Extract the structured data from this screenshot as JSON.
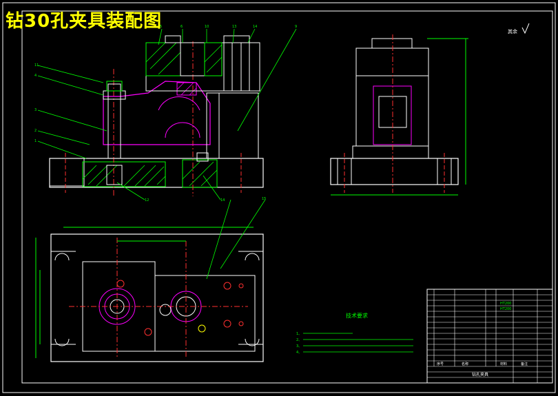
{
  "title": "钻30孔夹具装配图",
  "roughness_mark": "其余",
  "tech_requirements": {
    "heading": "技术要求",
    "items": [
      "1、",
      "2、",
      "3、",
      "4、"
    ]
  },
  "part_balloons": [
    "11",
    "4",
    "3",
    "2",
    "1",
    "5",
    "6",
    "10",
    "13",
    "14",
    "9",
    "12",
    "14",
    "15"
  ],
  "title_block": {
    "drawing_name": "钻孔夹具",
    "material_header": "材料",
    "notes_header": "备注",
    "col_no": "序号",
    "col_name": "名称",
    "materials": [
      "HT200",
      "HT200"
    ]
  },
  "colors": {
    "frame": "#ffffff",
    "green": "#00ff00",
    "magenta": "#ff00ff",
    "red": "#ff3030",
    "yellow": "#ffff00",
    "cyan": "#00ffff",
    "white": "#ffffff"
  }
}
